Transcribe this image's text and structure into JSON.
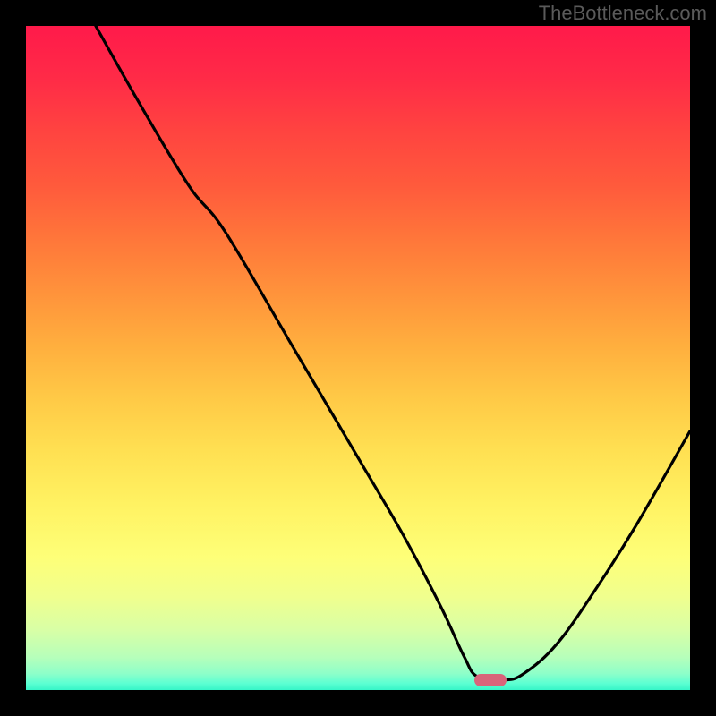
{
  "watermark": "TheBottleneck.com",
  "chart_data": {
    "type": "line",
    "title": "",
    "xlabel": "",
    "ylabel": "",
    "xlim": [
      0,
      100
    ],
    "ylim": [
      0,
      100
    ],
    "grid": false,
    "series": [
      {
        "name": "curve",
        "x": [
          10.5,
          17.0,
          24.5,
          30.0,
          40.0,
          50.0,
          57.0,
          62.5,
          66.0,
          68.0,
          72.0,
          75.0,
          80.0,
          86.0,
          92.0,
          100.0
        ],
        "y": [
          100.0,
          88.5,
          76.0,
          69.0,
          52.0,
          35.0,
          23.0,
          12.5,
          5.0,
          2.0,
          1.5,
          2.5,
          7.0,
          15.5,
          25.0,
          39.0
        ]
      }
    ],
    "legend": false,
    "marker": {
      "x": 70,
      "y": 1.5,
      "color": "#d8647a"
    },
    "gradient_stops": [
      {
        "pos": 0,
        "color": "#ff1a4a"
      },
      {
        "pos": 50,
        "color": "#ffb840"
      },
      {
        "pos": 80,
        "color": "#feff78"
      },
      {
        "pos": 100,
        "color": "#36f5c8"
      }
    ]
  }
}
